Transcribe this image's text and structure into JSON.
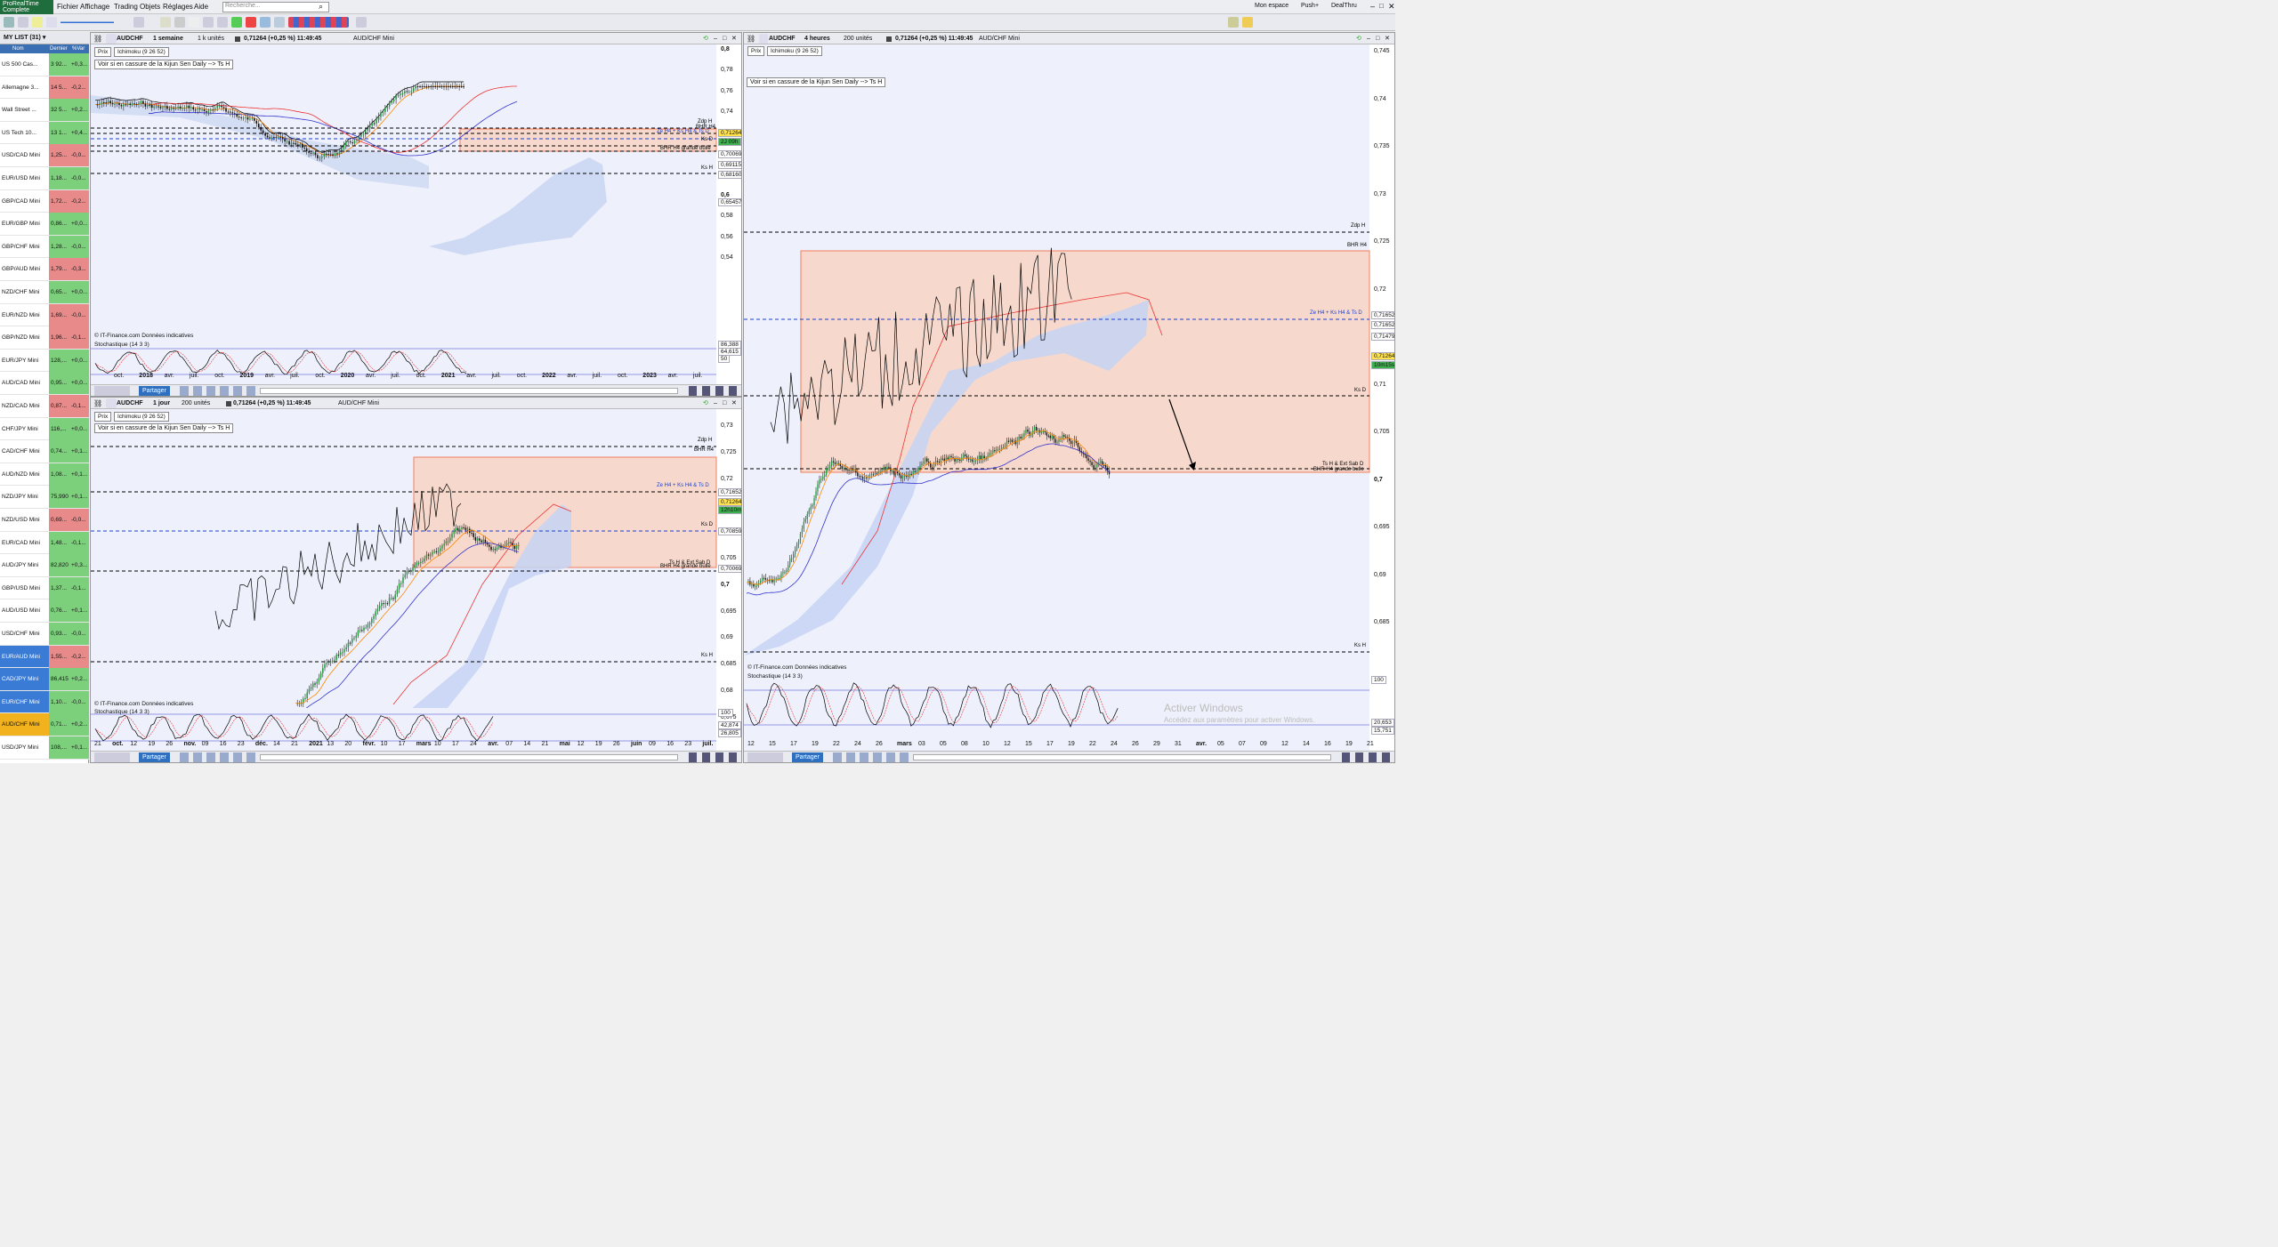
{
  "app": {
    "logo_line1": "ProRealTime",
    "logo_line2": "Complete",
    "menus": [
      "Fichier",
      "Affichage",
      "Trading",
      "Objets",
      "Réglages",
      "Aide"
    ],
    "search_placeholder": "Recherche...",
    "right": [
      "Mon espace",
      "Push+",
      "DealThru"
    ]
  },
  "watchlist": {
    "title": "MY LIST (31)",
    "cols": [
      "Nom",
      "Dernier",
      "%Var"
    ],
    "rows": [
      {
        "n": "US 500 Cas...",
        "d": "3 92...",
        "v": "+0,3...",
        "c": "#7cd07c"
      },
      {
        "n": "Allemagne 3...",
        "d": "14 5...",
        "v": "-0,2...",
        "c": "#e88a8a"
      },
      {
        "n": "Wall Street ...",
        "d": "32 5...",
        "v": "+0,2...",
        "c": "#7cd07c"
      },
      {
        "n": "US Tech 10...",
        "d": "13 1...",
        "v": "+0,4...",
        "c": "#7cd07c"
      },
      {
        "n": "USD/CAD Mini",
        "d": "1,25...",
        "v": "-0,0...",
        "c": "#e88a8a"
      },
      {
        "n": "EUR/USD Mini",
        "d": "1,18...",
        "v": "-0,0...",
        "c": "#7cd07c"
      },
      {
        "n": "GBP/CAD Mini",
        "d": "1,72...",
        "v": "-0,2...",
        "c": "#e88a8a"
      },
      {
        "n": "EUR/GBP Mini",
        "d": "0,86...",
        "v": "+0,0...",
        "c": "#7cd07c"
      },
      {
        "n": "GBP/CHF Mini",
        "d": "1,28...",
        "v": "-0,0...",
        "c": "#7cd07c"
      },
      {
        "n": "GBP/AUD Mini",
        "d": "1,79...",
        "v": "-0,3...",
        "c": "#e88a8a"
      },
      {
        "n": "NZD/CHF Mini",
        "d": "0,65...",
        "v": "+0,0...",
        "c": "#7cd07c"
      },
      {
        "n": "EUR/NZD Mini",
        "d": "1,69...",
        "v": "-0,0...",
        "c": "#e88a8a"
      },
      {
        "n": "GBP/NZD Mini",
        "d": "1,96...",
        "v": "-0,1...",
        "c": "#e88a8a"
      },
      {
        "n": "EUR/JPY Mini",
        "d": "128,...",
        "v": "+0,0...",
        "c": "#7cd07c"
      },
      {
        "n": "AUD/CAD Mini",
        "d": "0,95...",
        "v": "+0,0...",
        "c": "#7cd07c"
      },
      {
        "n": "NZD/CAD Mini",
        "d": "0,87...",
        "v": "-0,1...",
        "c": "#e88a8a"
      },
      {
        "n": "CHF/JPY Mini",
        "d": "116,...",
        "v": "+0,0...",
        "c": "#7cd07c"
      },
      {
        "n": "CAD/CHF Mini",
        "d": "0,74...",
        "v": "+0,1...",
        "c": "#7cd07c"
      },
      {
        "n": "AUD/NZD Mini",
        "d": "1,08...",
        "v": "+0,1...",
        "c": "#7cd07c"
      },
      {
        "n": "NZD/JPY Mini",
        "d": "75,990",
        "v": "+0,1...",
        "c": "#7cd07c"
      },
      {
        "n": "NZD/USD Mini",
        "d": "0,69...",
        "v": "-0,0...",
        "c": "#e88a8a"
      },
      {
        "n": "EUR/CAD Mini",
        "d": "1,48...",
        "v": "-0,1...",
        "c": "#7cd07c"
      },
      {
        "n": "AUD/JPY Mini",
        "d": "82,820",
        "v": "+0,3...",
        "c": "#7cd07c"
      },
      {
        "n": "GBP/USD Mini",
        "d": "1,37...",
        "v": "-0,1...",
        "c": "#7cd07c"
      },
      {
        "n": "AUD/USD Mini",
        "d": "0,76...",
        "v": "+0,1...",
        "c": "#7cd07c"
      },
      {
        "n": "USD/CHF Mini",
        "d": "0,93...",
        "v": "-0,0...",
        "c": "#7cd07c"
      },
      {
        "n": "EUR/AUD Mini",
        "d": "1,55...",
        "v": "-0,2...",
        "c": "#e88a8a"
      },
      {
        "n": "CAD/JPY Mini",
        "d": "86,415",
        "v": "+0,2...",
        "c": "#7cd07c"
      },
      {
        "n": "EUR/CHF Mini",
        "d": "1,10...",
        "v": "-0,0...",
        "c": "#7cd07c"
      },
      {
        "n": "AUD/CHF Mini",
        "d": "0,71...",
        "v": "+0,2...",
        "c": "#7cd07c"
      },
      {
        "n": "USD/JPY Mini",
        "d": "108,...",
        "v": "+0,1...",
        "c": "#7cd07c"
      }
    ]
  },
  "pane_w": {
    "symbol": "AUDCHF",
    "tf": "1 semaine",
    "units": "1 k unités",
    "quote": "0,71264 (+0,25 %) 11:49:45",
    "name": "AUD/CHF Mini",
    "legend_prix": "Prix",
    "legend_ichi": "Ichimoku (9 26 52)",
    "comment": "Voir si en cassure de la Kijun Sen Daily --> Ts H",
    "source": "© IT-Finance.com Données indicatives",
    "stoch": "Stochastique (14 3 3)",
    "share": "Partager",
    "yticks": [
      "0,8",
      "0,78",
      "0,76",
      "0,74",
      "0,66",
      "0,64",
      "0,62",
      "0,6",
      "0,58",
      "0,56",
      "0,54"
    ],
    "xticks": [
      "oct.",
      "2018",
      "avr.",
      "juil.",
      "oct.",
      "2019",
      "avr.",
      "juil.",
      "oct.",
      "2020",
      "avr.",
      "juil.",
      "oct.",
      "2021",
      "avr.",
      "juil.",
      "oct.",
      "2022",
      "avr.",
      "juil.",
      "oct.",
      "2023",
      "avr.",
      "juil."
    ],
    "tags": [
      "0,71264",
      "2J 09h",
      "0,70069",
      "0,69115",
      "0,68160",
      "0,65457",
      "86,388",
      "64,615",
      "50"
    ],
    "notes": [
      "Zdp H",
      "BHR H4",
      "Ze H4 + Ks H4 & Ts D",
      "Ks D",
      "BHR H4 grande bulle",
      "Ks H"
    ]
  },
  "pane_d": {
    "symbol": "AUDCHF",
    "tf": "1 jour",
    "units": "200 unités",
    "quote": "0,71264 (+0,25 %) 11:49:45",
    "name": "AUD/CHF Mini",
    "legend_prix": "Prix",
    "legend_ichi": "Ichimoku (9 26 52)",
    "comment": "Voir si en cassure de la Kijun Sen Daily --> Ts H",
    "source": "© IT-Finance.com Données indicatives",
    "stoch": "Stochastique (14 3 3)",
    "share": "Partager",
    "yticks": [
      "0,73",
      "0,725",
      "0,72",
      "0,715",
      "0,71",
      "0,705",
      "0,7",
      "0,695",
      "0,69",
      "0,685",
      "0,68",
      "0,675"
    ],
    "xticks": [
      "21",
      "oct.",
      "12",
      "19",
      "26",
      "nov.",
      "09",
      "16",
      "23",
      "déc.",
      "14",
      "21",
      "2021",
      "13",
      "20",
      "févr.",
      "10",
      "17",
      "mars",
      "10",
      "17",
      "24",
      "avr.",
      "07",
      "14",
      "21",
      "mai",
      "12",
      "19",
      "26",
      "juin",
      "09",
      "16",
      "23",
      "juil."
    ],
    "tags": [
      "0,71652",
      "0,71264",
      "12h10m",
      "0,70859",
      "0,70069",
      "100",
      "42,874",
      "26,805"
    ],
    "notes": [
      "Zdp H",
      "BHR H4",
      "Ze H4 + Ks H4 & Ts D",
      "Ks D",
      "Ts H & Ext Sab D",
      "BHR H4 grande bulle",
      "Ks H"
    ]
  },
  "pane_h": {
    "symbol": "AUDCHF",
    "tf": "4 heures",
    "units": "200 unités",
    "quote": "0,71264 (+0,25 %) 11:49:45",
    "name": "AUD/CHF Mini",
    "legend_prix": "Prix",
    "legend_ichi": "Ichimoku (9 26 52)",
    "comment": "Voir si en cassure de la Kijun Sen Daily --> Ts H",
    "source": "© IT-Finance.com Données indicatives",
    "stoch": "Stochastique (14 3 3)",
    "share": "Partager",
    "yticks": [
      "0,745",
      "0,74",
      "0,735",
      "0,73",
      "0,725",
      "0,72",
      "0,715",
      "0,71",
      "0,705",
      "0,7",
      "0,695",
      "0,69",
      "0,685"
    ],
    "xticks": [
      "12",
      "15",
      "17",
      "19",
      "22",
      "24",
      "26",
      "mars",
      "03",
      "05",
      "08",
      "10",
      "12",
      "15",
      "17",
      "19",
      "22",
      "24",
      "26",
      "29",
      "31",
      "avr.",
      "05",
      "07",
      "09",
      "12",
      "14",
      "16",
      "19",
      "21"
    ],
    "tags": [
      "0,71652",
      "0,71652",
      "0,71479",
      "0,71264",
      "10m15s",
      "100",
      "20,653",
      "15,751"
    ],
    "notes": [
      "Zdp H",
      "BHR H4",
      "Ze H4 + Ks H4 & Ts D",
      "Ks D",
      "Ts H & Ext Sab D",
      "BHR H4 grande bulle",
      "Ks H"
    ]
  },
  "overlay": {
    "line1": "Activer Windows",
    "line2": "Accédez aux paramètres pour activer Windows."
  }
}
